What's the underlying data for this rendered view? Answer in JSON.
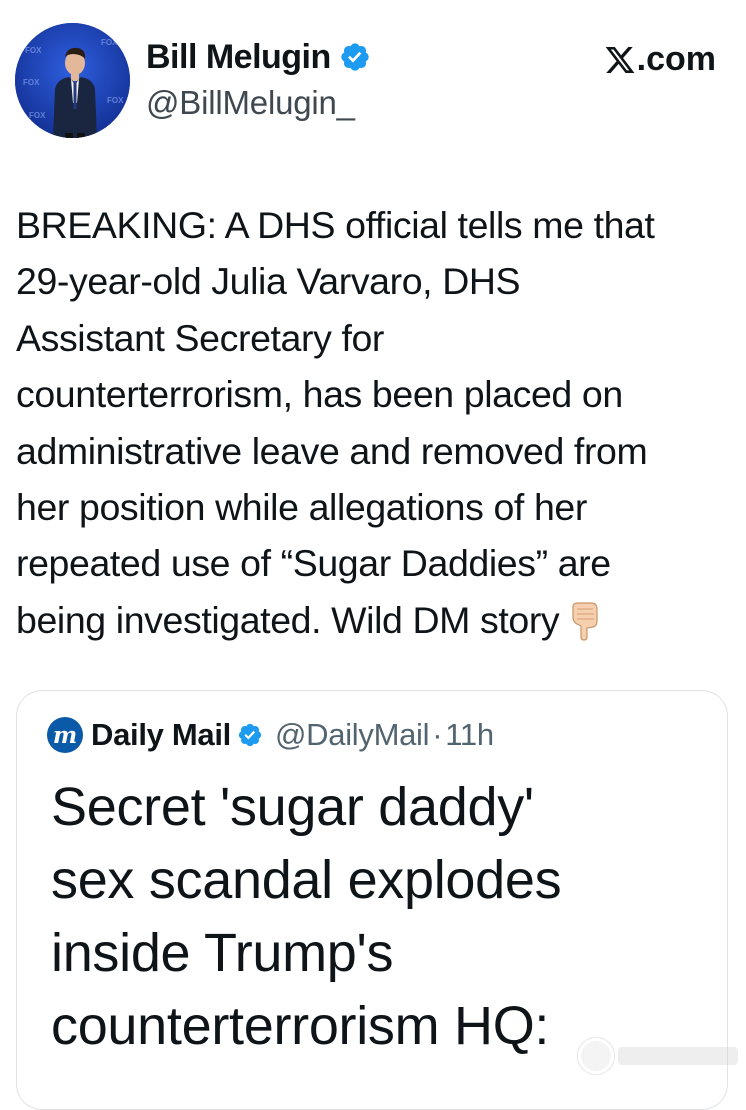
{
  "author": {
    "display_name": "Bill Melugin",
    "handle": "@BillMelugin_",
    "verified_icon": "verified-badge-icon",
    "avatar_icon": "profile-photo"
  },
  "site": {
    "label": ".com",
    "logo": "x-logo-icon"
  },
  "tweet": {
    "text": "BREAKING: A DHS official tells me that\n29-year-old Julia Varvaro, DHS\nAssistant Secretary for\ncounterterrorism, has been placed on\nadministrative leave and removed from\nher position while allegations of her\nrepeated use of “Sugar Daddies” are\nbeing investigated. Wild DM story",
    "emoji": "backhand-index-pointing-down-icon"
  },
  "quoted": {
    "name": "Daily Mail",
    "logo_letter": "m",
    "handle": "@DailyMail",
    "separator": "·",
    "time": "11h",
    "headline": "Secret 'sugar daddy'\nsex scandal explodes\ninside Trump's\ncounterterrorism HQ:"
  },
  "colors": {
    "verified_blue": "#1d9bf0",
    "dm_blue": "#0a5aa8",
    "text": "#0f1419",
    "muted": "#536471",
    "border": "#dfe3e6"
  }
}
